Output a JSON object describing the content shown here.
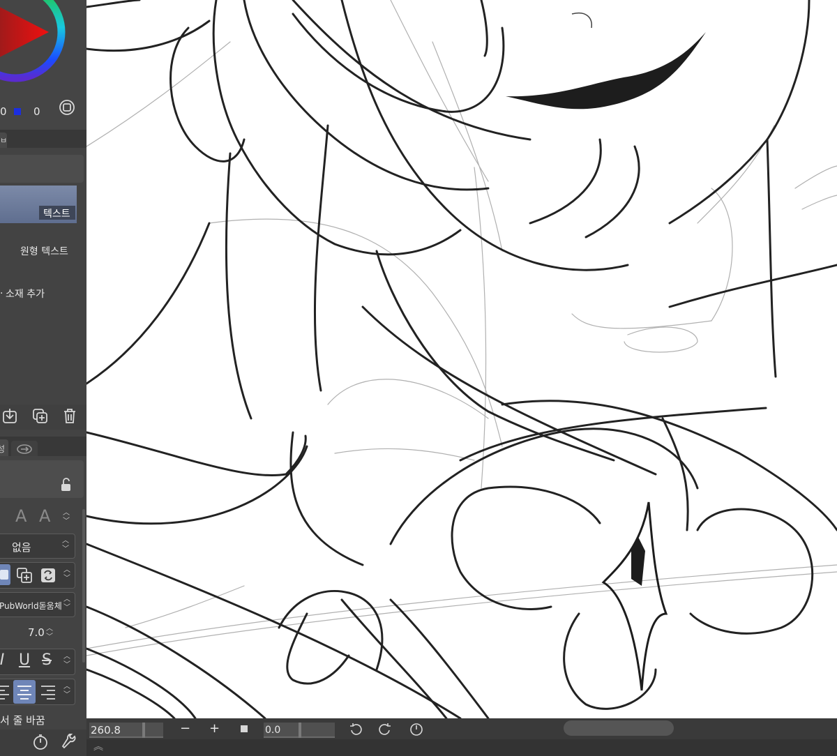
{
  "color_panel": {
    "value_a": "0",
    "value_b": "0",
    "accent": "#d61f26",
    "icon": "frame-icon"
  },
  "tabs_top": {
    "label": "ㅂ"
  },
  "text_options": {
    "selected_label": "텍스트",
    "item_round_text": "원형 텍스트",
    "add_material": "소재 추가"
  },
  "layer_actions": [
    "import-icon",
    "duplicate-icon",
    "trash-icon"
  ],
  "tool_tabs": {
    "tab_label": "성"
  },
  "property": {
    "lock_icon": "unlock-icon",
    "none_value": "없음",
    "font_name": "PubWorld돋움체",
    "size_value": "7.0",
    "style_buttons": [
      "I",
      "U",
      "S"
    ],
    "wrap_label": "서 줄 바꿈"
  },
  "bottom_bar": {
    "zoom_value": "260.8",
    "minus": "−",
    "plus": "+",
    "rotation_value": "0.0"
  }
}
